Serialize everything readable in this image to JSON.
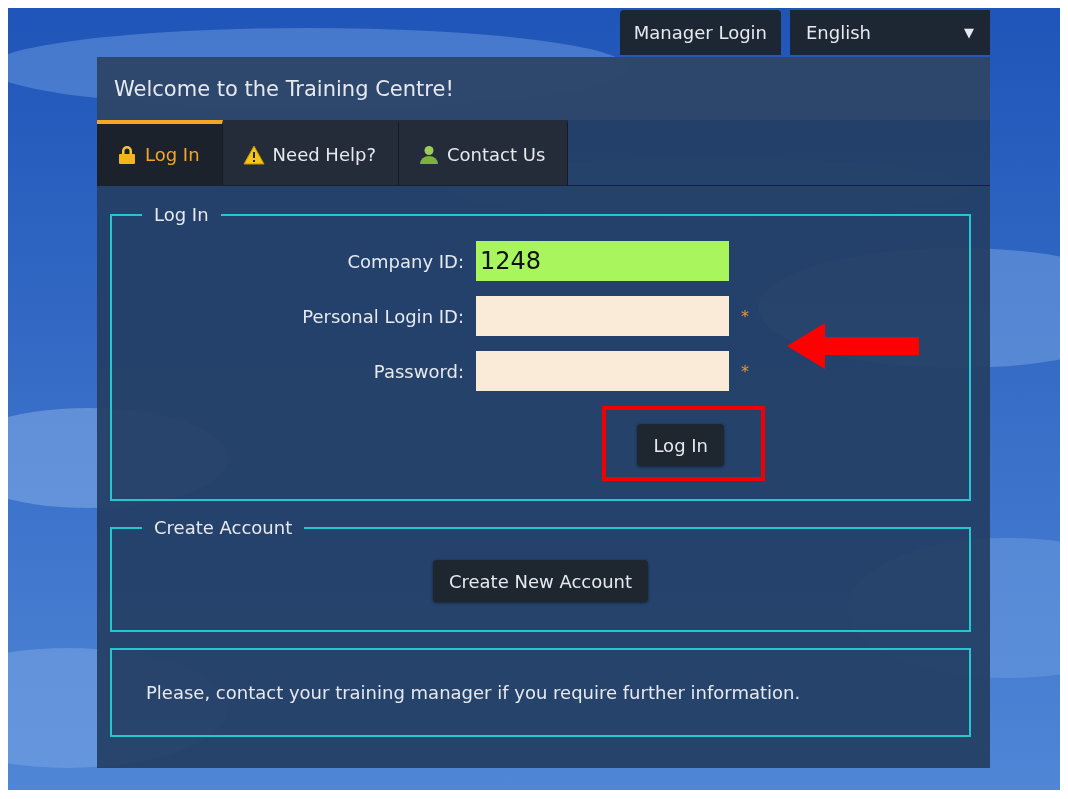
{
  "top_bar": {
    "manager_login": "Manager Login",
    "language": {
      "value": "English",
      "caret": "▼"
    }
  },
  "panel": {
    "title": "Welcome to the Training Centre!"
  },
  "tabs": [
    {
      "label": "Log In",
      "kind": "lock",
      "selected": true
    },
    {
      "label": "Need Help?",
      "kind": "warning",
      "selected": false
    },
    {
      "label": "Contact Us",
      "kind": "person",
      "selected": false
    }
  ],
  "login": {
    "legend": "Log In",
    "fields": [
      {
        "label": "Company ID:",
        "value": "1248",
        "focused": true,
        "kind": "text"
      },
      {
        "label": "Personal Login ID:",
        "focused": false,
        "kind": "text",
        "required_mark": "*"
      },
      {
        "label": "Password:",
        "focused": false,
        "kind": "password",
        "required_mark": "*"
      }
    ],
    "submit": {
      "label": "Log In",
      "highlighted": true
    }
  },
  "create_account": {
    "legend": "Create Account",
    "button": "Create New Account"
  },
  "info": "Please, contact your training manager if you require further information.",
  "annotations": [
    {
      "kind": "arrow"
    }
  ]
}
